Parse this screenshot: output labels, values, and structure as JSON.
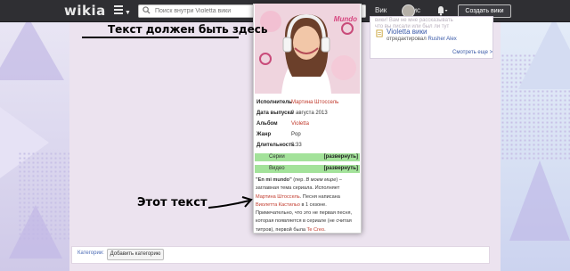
{
  "topbar": {
    "logo": "wikia",
    "search_placeholder": "Поиск внутри Violetta вики",
    "user_name": "Вик",
    "user_name_tail": "ктис",
    "create_wiki": "Создать вики"
  },
  "annotations": {
    "top": "Текст должен быть здесь",
    "bottom": "Этот текст"
  },
  "rail": {
    "line1": "вики! Вам не мне рассказывать",
    "line2": "что вы писали или был ли тут",
    "wiki_link": "Violetta вики",
    "edit_prefix": "отредактировал ",
    "edit_user": "Rusher Alex",
    "more": "Смотреть еще >"
  },
  "infobox": {
    "image_title": "Mundo",
    "rows": [
      {
        "label": "Исполнитель",
        "value": "Мартина Штоссель",
        "link": true
      },
      {
        "label": "Дата выпуска",
        "value": "9 августа 2013",
        "link": false
      },
      {
        "label": "Альбом",
        "value": "Violetta",
        "link": true
      },
      {
        "label": "Жанр",
        "value": "Pop",
        "link": false
      },
      {
        "label": "Длительность",
        "value": "3:33",
        "link": false
      }
    ],
    "collapsibles": [
      {
        "label": "Серии",
        "action": "[развернуть]"
      },
      {
        "label": "Видео",
        "action": "[развернуть]"
      }
    ],
    "description": {
      "song": "\"En mi mundo\"",
      "translation_open": " (пер. ",
      "translation": "В моем мире",
      "translation_close": ") – заглавная тема сериала. Исполняет ",
      "singer": "Мартина Штоссель",
      "written": ". Песня написана ",
      "character": "Виолетта Кастильо",
      "rest": " в 1 сезоне. Примечательно, что это не первая песня, которая появляется в сериале (не считая титров), первой была ",
      "first_song": "Te Creo",
      "end": "."
    }
  },
  "categories": {
    "label": "Категории:",
    "add_button": "Добавить категорию"
  },
  "colors": {
    "topbar": "#2f2f33",
    "content_bg": "#ece3ef",
    "collapsible_bg": "#a3e29a",
    "link": "#3a5aa8",
    "red_link": "#c0392b"
  }
}
